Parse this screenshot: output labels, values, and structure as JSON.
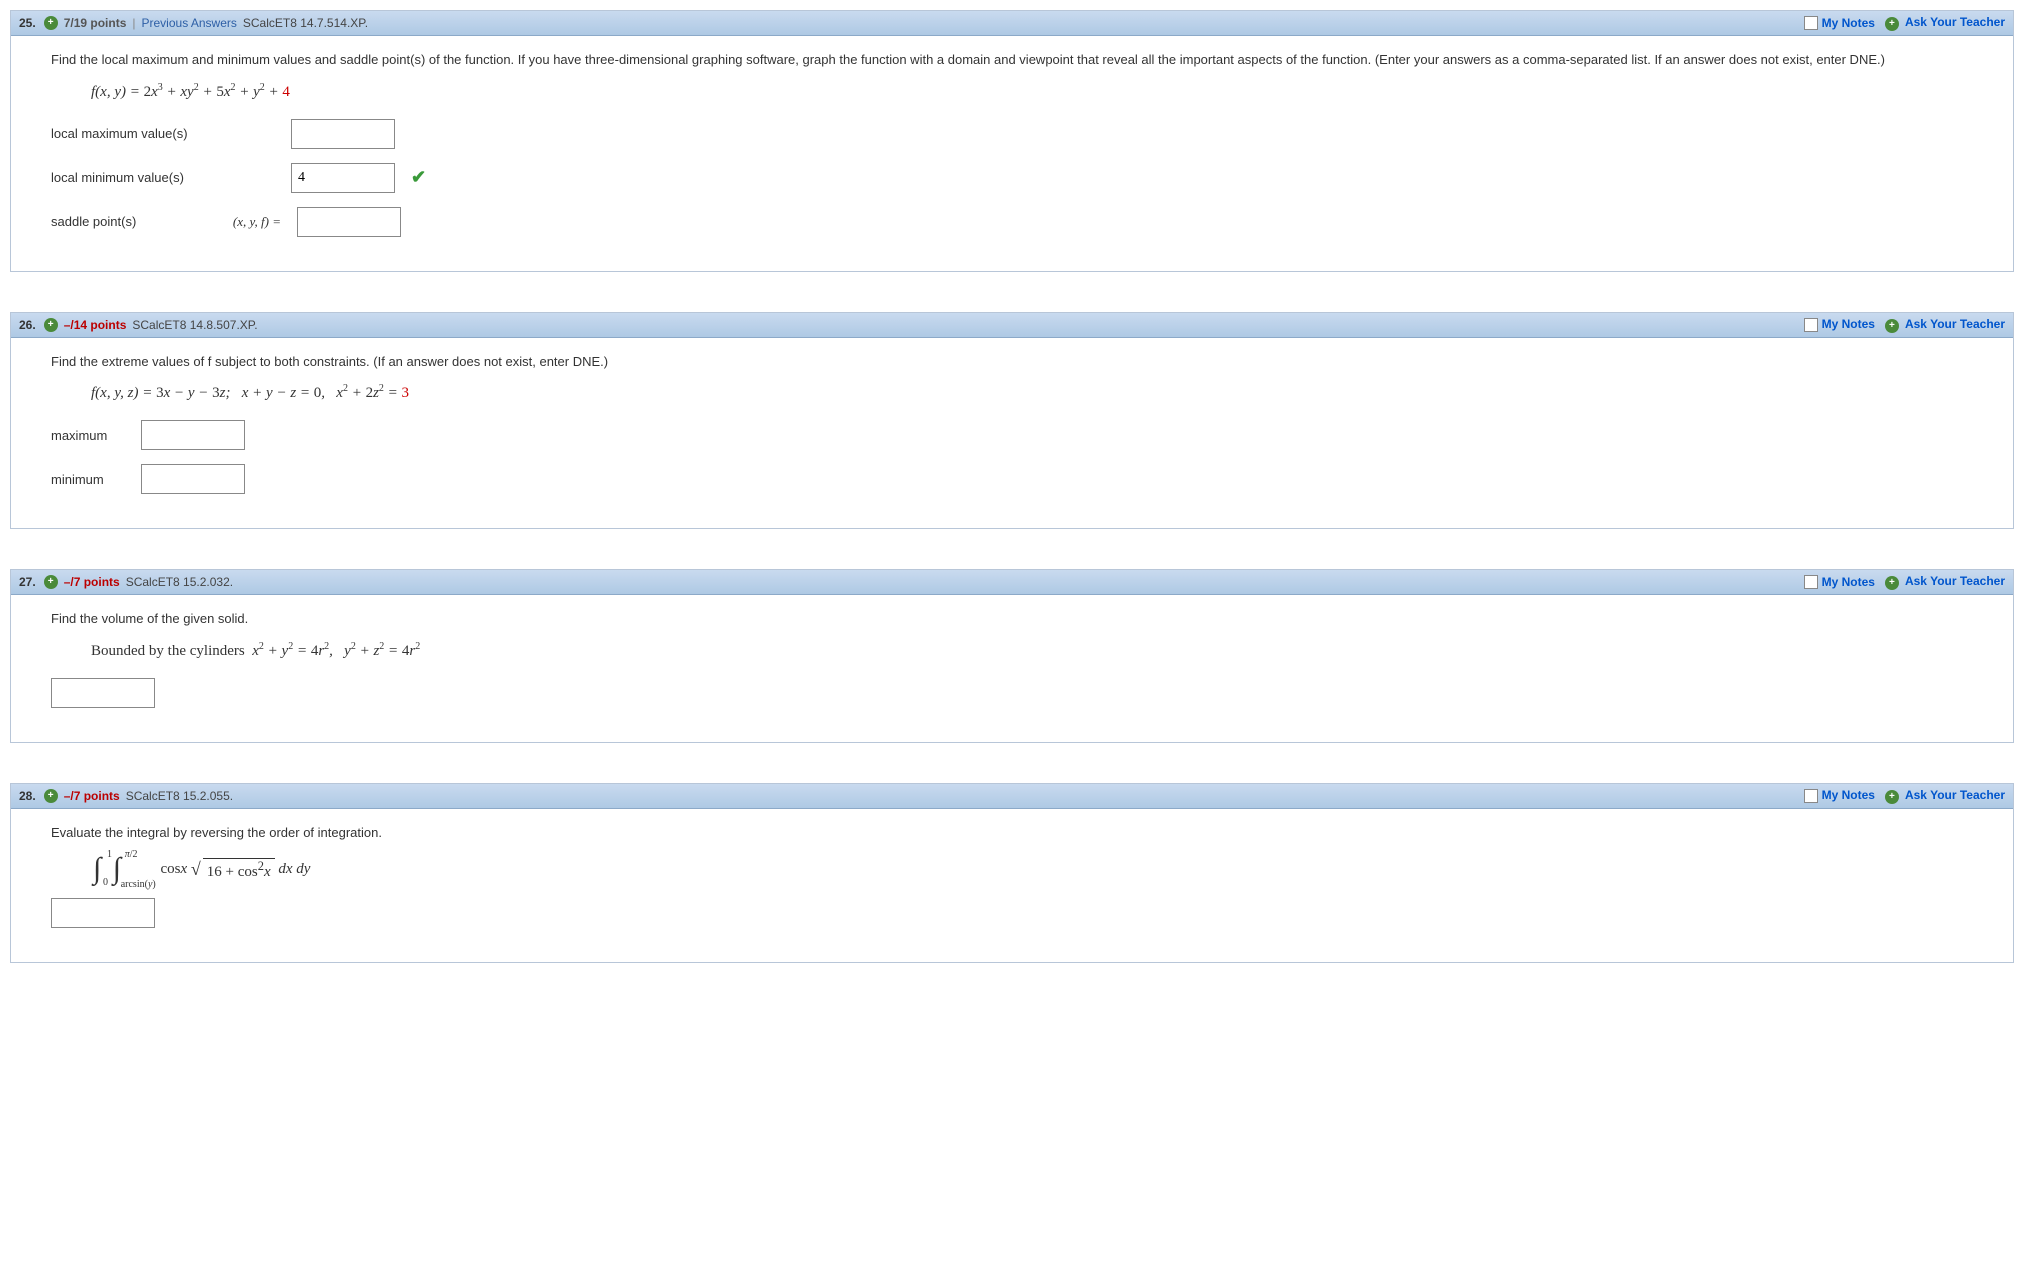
{
  "q25": {
    "num": "25.",
    "points": "7/19 points",
    "prev": "Previous Answers",
    "source": "SCalcET8 14.7.514.XP.",
    "mynotes": "My Notes",
    "ask": "Ask Your Teacher",
    "prompt": "Find the local maximum and minimum values and saddle point(s) of the function. If you have three-dimensional graphing software, graph the function with a domain and viewpoint that reveal all the important aspects of the function. (Enter your answers as a comma-separated list. If an answer does not exist, enter DNE.)",
    "label_max": "local maximum value(s)",
    "label_min": "local minimum value(s)",
    "label_saddle": "saddle point(s)",
    "saddle_prefix": "(x, y, f) =",
    "min_value": "4"
  },
  "q26": {
    "num": "26.",
    "points": "–/14 points",
    "source": "SCalcET8 14.8.507.XP.",
    "mynotes": "My Notes",
    "ask": "Ask Your Teacher",
    "prompt": "Find the extreme values of f subject to both constraints. (If an answer does not exist, enter DNE.)",
    "label_max": "maximum",
    "label_min": "minimum"
  },
  "q27": {
    "num": "27.",
    "points": "–/7 points",
    "source": "SCalcET8 15.2.032.",
    "mynotes": "My Notes",
    "ask": "Ask Your Teacher",
    "prompt": "Find the volume of the given solid.",
    "sub": "Bounded by the cylinders "
  },
  "q28": {
    "num": "28.",
    "points": "–/7 points",
    "source": "SCalcET8 15.2.055.",
    "mynotes": "My Notes",
    "ask": "Ask Your Teacher",
    "prompt": "Evaluate the integral by reversing the order of integration."
  }
}
